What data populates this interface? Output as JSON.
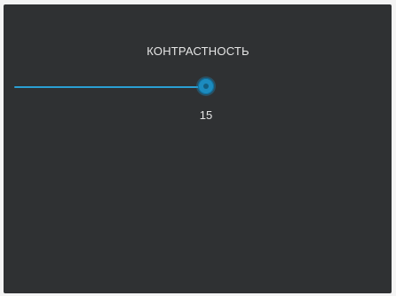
{
  "dialog": {
    "title": "КОНТРАСТНОСТЬ"
  },
  "slider": {
    "value_label": "15",
    "fill_fraction": 0.94,
    "accent_color": "#2a9fd3"
  }
}
